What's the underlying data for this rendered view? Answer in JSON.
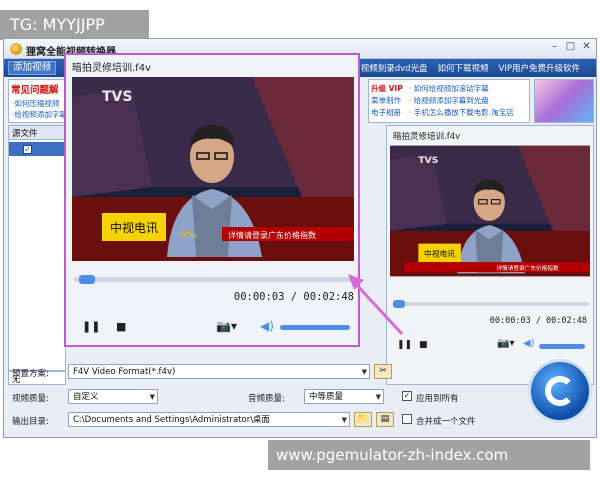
{
  "app": {
    "title": "狸窝全能视频转换器",
    "toolbar": {
      "add_video": "添加视频",
      "links": [
        "视频刻录dvd光盘",
        "如何下载视频",
        "VIP用户免费升级软件"
      ]
    },
    "faq": {
      "title": "常见问题解",
      "items": [
        "·如何压缩视频",
        "·给视频添加字幕"
      ]
    },
    "promo": {
      "col1": [
        "升级 VIP",
        "菜单制作",
        "电子相册"
      ],
      "col2": [
        "· 如何给视频加滚动字幕",
        "· 给视频添加字幕到光盘",
        "· 手机怎么播放下载电影 淘宝店"
      ]
    },
    "filelist": {
      "header": "源文件",
      "none_label": "无"
    },
    "preview": {
      "title": "暗拍灵修培训.f4v",
      "time": "00:00:03 / 00:02:48"
    },
    "settings": {
      "preset_label": "预置方案:",
      "preset_value": "F4V Video Format(*.f4v)",
      "video_quality_label": "视频质量:",
      "video_quality_value": "自定义",
      "audio_quality_label": "音频质量:",
      "audio_quality_value": "中等质量",
      "apply_all": "应用到所有",
      "output_label": "输出目录:",
      "output_path": "C:\\Documents and Settings\\Administrator\\桌面",
      "merge": "合并成一个文件"
    }
  },
  "player": {
    "title": "暗拍灵修培训.f4v",
    "time": "00:00:03 / 00:02:48",
    "progress": 0.02,
    "volume": 0.85,
    "video": {
      "channel_logo": "TVS",
      "caption_logo": "中视电讯",
      "ticker_num": "6%。",
      "ticker_text": "详情请登录广东价格指数"
    }
  },
  "watermark_top": "TG: MYYJJPP",
  "watermark_bottom": "www.pgemulator-zh-index.com",
  "colors": {
    "player_border": "#c05ad0",
    "toolbar": "#1f4f9e",
    "accent": "#4d8ee3"
  }
}
